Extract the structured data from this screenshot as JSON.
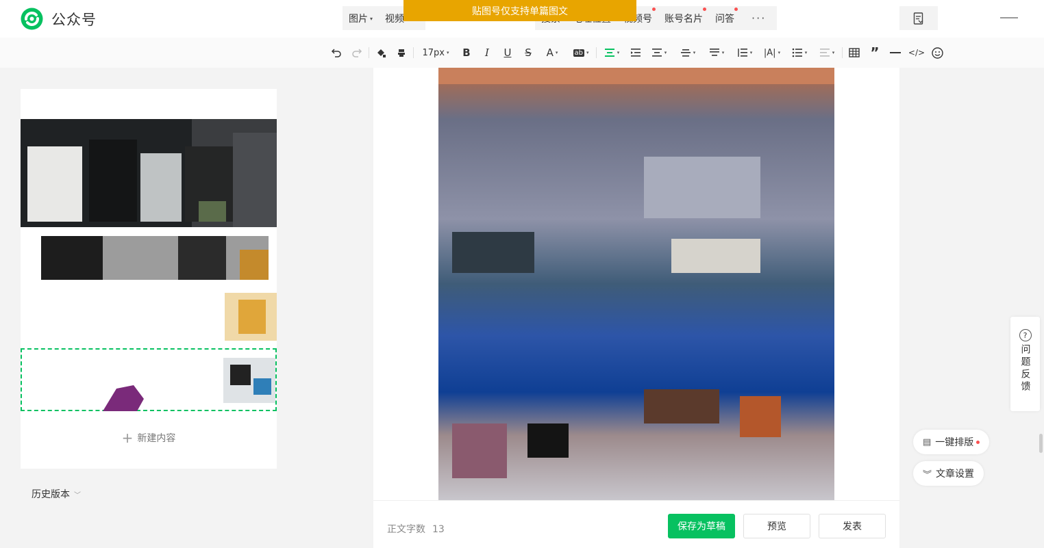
{
  "brand": {
    "name": "公众号"
  },
  "banner": {
    "text": "贴图号仅支持单篇图文"
  },
  "insert_menu": {
    "items": [
      {
        "label": "图片",
        "caret": true,
        "dot": false
      },
      {
        "label": "视频",
        "caret": false,
        "dot": false
      },
      {
        "label": "搜索",
        "caret": false,
        "dot": false
      },
      {
        "label": "地理位置",
        "caret": false,
        "dot": false
      },
      {
        "label": "视频号",
        "caret": false,
        "dot": true
      },
      {
        "label": "账号名片",
        "caret": false,
        "dot": true
      },
      {
        "label": "问答",
        "caret": false,
        "dot": true
      }
    ],
    "more": "···"
  },
  "toolbar": {
    "font_size": "17px",
    "icons": [
      "undo-icon",
      "redo-icon",
      "format-painter-icon",
      "clear-format-icon",
      "font-size-select",
      "bold-icon",
      "italic-icon",
      "underline-icon",
      "strikethrough-icon",
      "font-color-icon",
      "background-color-icon",
      "align-center-icon",
      "indent-icon",
      "justify-icon",
      "vertical-align-icon",
      "paragraph-spacing-icon",
      "line-height-icon",
      "letter-spacing-icon",
      "list-icon",
      "border-icon",
      "table-icon",
      "quote-icon",
      "divider-icon",
      "code-icon",
      "emoji-icon"
    ]
  },
  "left_panel": {
    "items": [
      {
        "title": ""
      },
      {
        "title": ""
      },
      {
        "title": ""
      }
    ],
    "new_content": "新建内容"
  },
  "history": {
    "label": "历史版本"
  },
  "bottom_bar": {
    "word_count_label": "正文字数",
    "word_count": "13",
    "save_draft": "保存为草稿",
    "preview": "预览",
    "publish": "发表"
  },
  "floating": {
    "feedback": "问题反馈",
    "auto_layout": "一键排版",
    "article_settings": "文章设置"
  },
  "colors": {
    "accent": "#07c160",
    "banner": "#e8a500",
    "dot": "#fa5151"
  }
}
